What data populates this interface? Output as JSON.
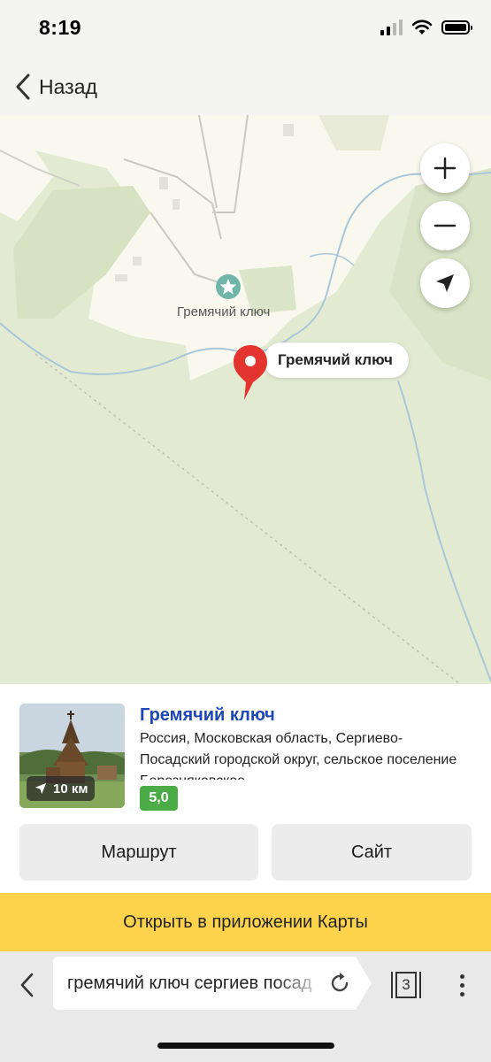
{
  "status_bar": {
    "time": "8:19"
  },
  "nav": {
    "back_label": "Назад"
  },
  "map": {
    "poi_label": "Гремячий ключ",
    "pin_label": "Гремячий ключ",
    "controls": {
      "zoom_in": "+",
      "zoom_out": "−"
    }
  },
  "card": {
    "title": "Гремячий ключ",
    "address": "Россия, Московская область, Сергиево-Посадский городской округ, сельское поселение Березняковское",
    "distance": "10 км",
    "rating": "5,0",
    "route_button": "Маршрут",
    "site_button": "Сайт"
  },
  "open_app_label": "Открыть в приложении Карты",
  "browser": {
    "url_text": "гремячий ключ сергиев посад",
    "tabs_count": "3"
  },
  "colors": {
    "title_blue": "#1d47b8",
    "rating_green": "#4bab46",
    "open_app_yellow": "#fcd34a",
    "pin_red": "#e3342f"
  }
}
